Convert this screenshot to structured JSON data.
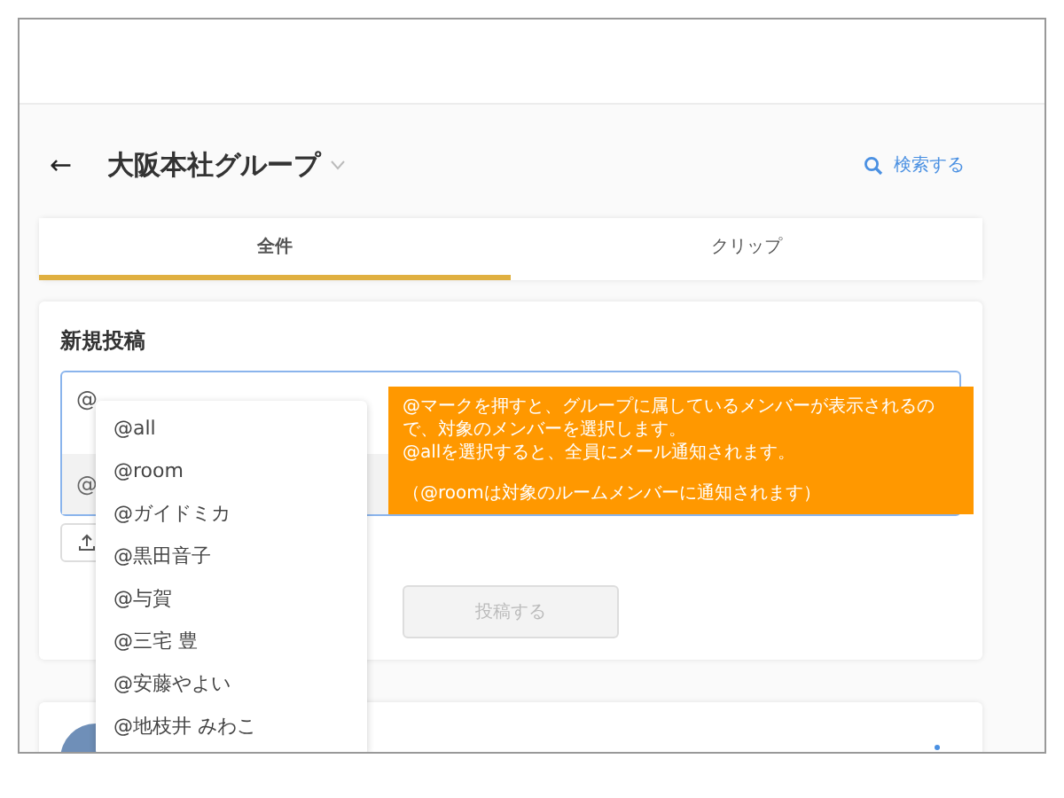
{
  "header": {
    "back": "←",
    "title": "大阪本社グループ",
    "search": "検索する"
  },
  "tabs": [
    {
      "label": "全件",
      "selected": true
    },
    {
      "label": "クリップ",
      "selected": false
    }
  ],
  "new_post": {
    "heading": "新規投稿",
    "value": "@",
    "mention_preview": "@",
    "post_button": {
      "label": "投稿する",
      "disabled": true
    }
  },
  "mention_menu": [
    "@all",
    "@room",
    "@ガイドミカ",
    "@黒田音子",
    "@与賀",
    "@三宅 豊",
    "@安藤やよい",
    "@地枝井 みわこ"
  ],
  "tooltip": [
    "@マークを押すと、グループに属しているメンバーが表示されるので、対象のメンバーを選択します。",
    "@allを選択すると、全員にメール通知されます。",
    "（@roomは対象のルームメンバーに通知されます）"
  ]
}
